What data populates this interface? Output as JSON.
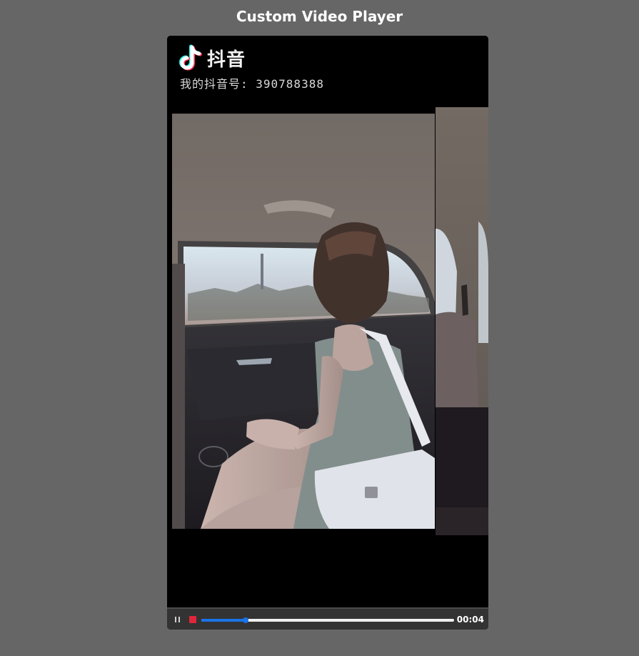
{
  "page": {
    "title": "Custom Video Player",
    "background_color": "#666666"
  },
  "video": {
    "watermark": {
      "brand": "抖音",
      "account": "我的抖音号: 390788388",
      "logo_icon": "tiktok-note-icon"
    },
    "scene": "car-interior-frame"
  },
  "controls": {
    "pause_icon": "pause-icon",
    "stop_icon": "stop-icon",
    "stop_color": "#e0263a",
    "progress_color": "#1a73e8",
    "progress_fraction": 0.175,
    "current_time": "00:04"
  }
}
